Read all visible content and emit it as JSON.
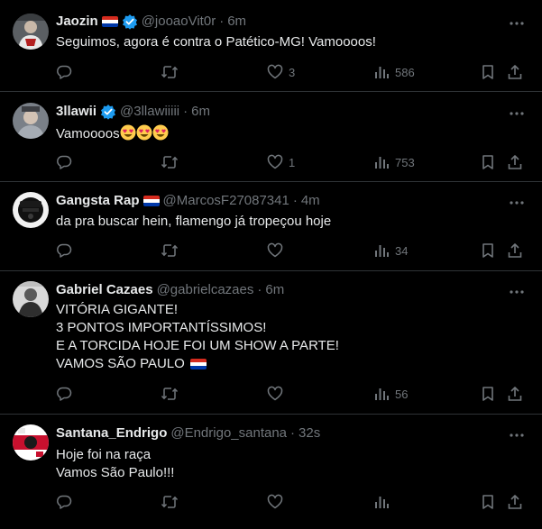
{
  "colors": {
    "background": "#000000",
    "text_primary": "#e7e9ea",
    "text_secondary": "#71767b",
    "divider": "#2f3336",
    "verified_blue": "#1d9bf0"
  },
  "tweets": [
    {
      "name": "Jaozin",
      "flag": "paraguay-flag",
      "verified": true,
      "handle": "@jooaoVit0r",
      "time": "6m",
      "lines": [
        "Seguimos, agora é contra o Patético-MG! Vamoooos!"
      ],
      "emojis": [],
      "replies": "",
      "retweets": "",
      "likes": "3",
      "views": "586"
    },
    {
      "name": "3llawii",
      "flag": "",
      "verified": true,
      "handle": "@3llawiiiii",
      "time": "6m",
      "lines": [
        "Vamoooos"
      ],
      "emojis": [
        "heart-eyes-emoji",
        "heart-eyes-emoji",
        "heart-eyes-emoji"
      ],
      "replies": "",
      "retweets": "",
      "likes": "1",
      "views": "753"
    },
    {
      "name": "Gangsta Rap",
      "flag": "paraguay-flag",
      "verified": false,
      "handle": "@MarcosF27087341",
      "time": "4m",
      "lines": [
        "da pra buscar hein, flamengo já tropeçou hoje"
      ],
      "emojis": [],
      "replies": "",
      "retweets": "",
      "likes": "",
      "views": "34"
    },
    {
      "name": "Gabriel Cazaes",
      "flag": "",
      "verified": false,
      "handle": "@gabrielcazaes",
      "time": "6m",
      "lines": [
        "VITÓRIA GIGANTE!",
        "3 PONTOS IMPORTANTÍSSIMOS!",
        "E A TORCIDA HOJE FOI UM SHOW A PARTE!",
        "VAMOS SÃO PAULO"
      ],
      "emojis": [],
      "replies": "",
      "retweets": "",
      "likes": "",
      "views": "56"
    },
    {
      "name": "Santana_Endrigo",
      "flag": "",
      "verified": false,
      "handle": "@Endrigo_santana",
      "time": "32s",
      "lines": [
        "Hoje foi na raça",
        "Vamos São Paulo!!!"
      ],
      "emojis": [],
      "replies": "",
      "retweets": "",
      "likes": "",
      "views": ""
    }
  ],
  "separator": "·"
}
